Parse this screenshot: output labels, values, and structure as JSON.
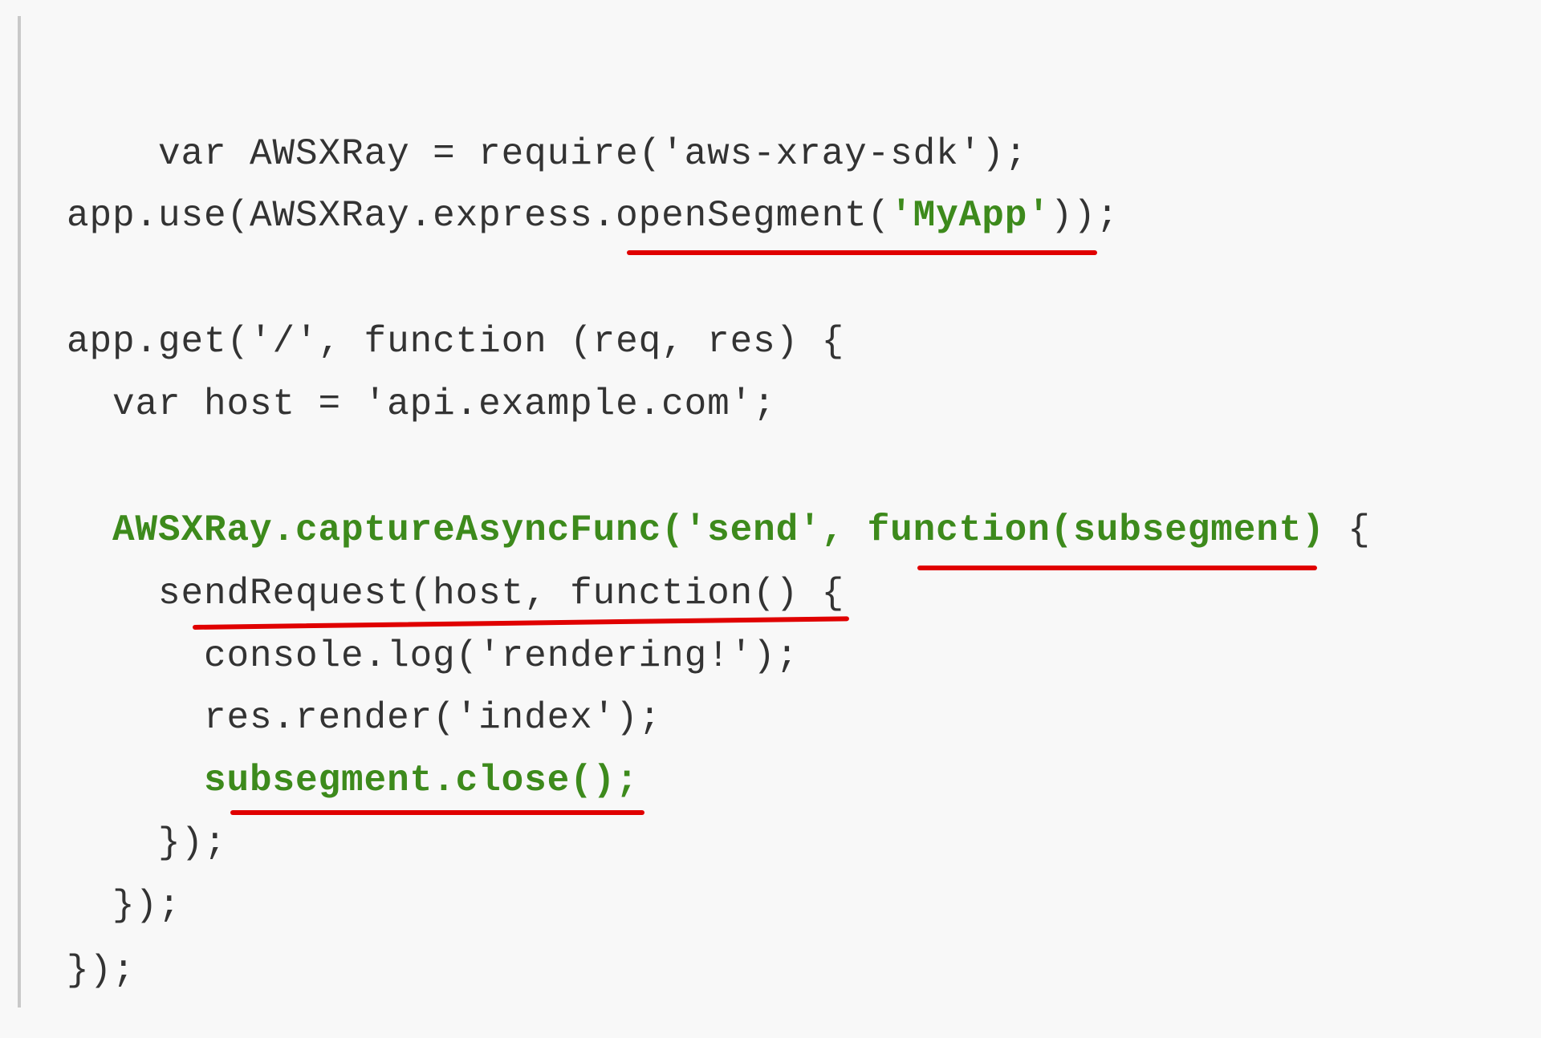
{
  "code_snippet": {
    "language": "javascript",
    "colors": {
      "background": "#f8f8f8",
      "text": "#333333",
      "highlight_green": "#3d8a1c",
      "annotation_red": "#e00000",
      "left_rule": "#c9c9c9"
    },
    "lines": [
      {
        "segments": [
          {
            "text": "var AWSXRay = require('aws-xray-sdk');",
            "style": "normal"
          }
        ]
      },
      {
        "segments": [
          {
            "text": "app.use(AWSXRay.express.openSegment(",
            "style": "normal"
          },
          {
            "text": "'MyApp'",
            "style": "green"
          },
          {
            "text": "));",
            "style": "normal"
          }
        ],
        "annotated": "openSegment('MyApp')"
      },
      {
        "segments": [
          {
            "text": "app.get('/', function (req, res) {",
            "style": "normal"
          }
        ]
      },
      {
        "segments": [
          {
            "text": "  var host = 'api.example.com';",
            "style": "normal"
          }
        ]
      },
      {
        "segments": [
          {
            "text": "  AWSXRay.captureAsyncFunc('send', function(subsegment)",
            "style": "green"
          },
          {
            "text": " {",
            "style": "normal"
          }
        ],
        "annotated": "function(subsegment)"
      },
      {
        "segments": [
          {
            "text": "    sendRequest(host, function() {",
            "style": "normal"
          }
        ],
        "annotated": "sendRequest(host, function() {"
      },
      {
        "segments": [
          {
            "text": "      console.log('rendering!');",
            "style": "normal"
          }
        ]
      },
      {
        "segments": [
          {
            "text": "      res.render('index');",
            "style": "normal"
          }
        ]
      },
      {
        "segments": [
          {
            "text": "      subsegment.close();",
            "style": "green"
          }
        ],
        "annotated": "subsegment.close();"
      },
      {
        "segments": [
          {
            "text": "    });",
            "style": "normal"
          }
        ]
      },
      {
        "segments": [
          {
            "text": "  });",
            "style": "normal"
          }
        ]
      },
      {
        "segments": [
          {
            "text": "});",
            "style": "normal"
          }
        ]
      }
    ]
  }
}
